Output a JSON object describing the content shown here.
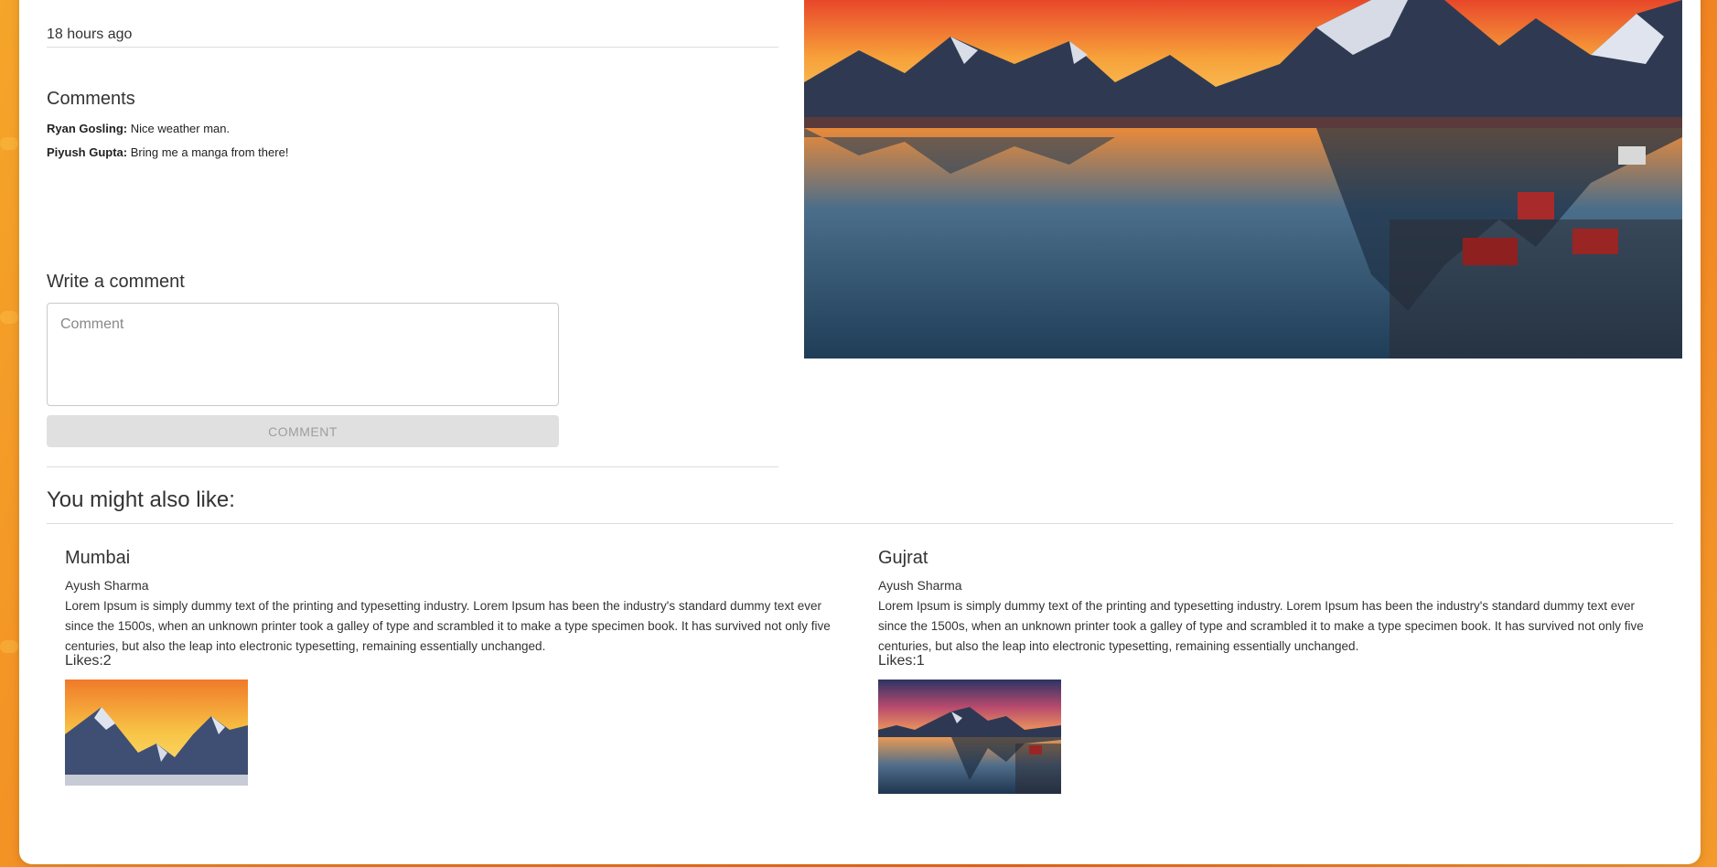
{
  "post": {
    "time_ago": "18 hours ago"
  },
  "comments": {
    "title": "Comments",
    "items": [
      {
        "author": "Ryan Gosling:",
        "text": " Nice weather man."
      },
      {
        "author": "Piyush Gupta:",
        "text": " Bring me a manga from there!"
      }
    ]
  },
  "write_comment": {
    "title": "Write a comment",
    "placeholder": "Comment",
    "button_label": "COMMENT"
  },
  "recommendations": {
    "title": "You might also like:",
    "items": [
      {
        "title": "Mumbai",
        "author": "Ayush Sharma",
        "description": "Lorem Ipsum is simply dummy text of the printing and typesetting industry. Lorem Ipsum has been the industry's standard dummy text ever since the 1500s, when an unknown printer took a galley of type and scrambled it to make a type specimen book. It has survived not only five centuries, but also the leap into electronic typesetting, remaining essentially unchanged.",
        "likes": "Likes:2"
      },
      {
        "title": "Gujrat",
        "author": "Ayush Sharma",
        "description": "Lorem Ipsum is simply dummy text of the printing and typesetting industry. Lorem Ipsum has been the industry's standard dummy text ever since the 1500s, when an unknown printer took a galley of type and scrambled it to make a type specimen book. It has survived not only five centuries, but also the leap into electronic typesetting, remaining essentially unchanged.",
        "likes": "Likes:1"
      }
    ]
  },
  "colors": {
    "background_orange": "#ef6a18",
    "button_disabled": "#e0e0e0",
    "divider": "#dddddd"
  }
}
